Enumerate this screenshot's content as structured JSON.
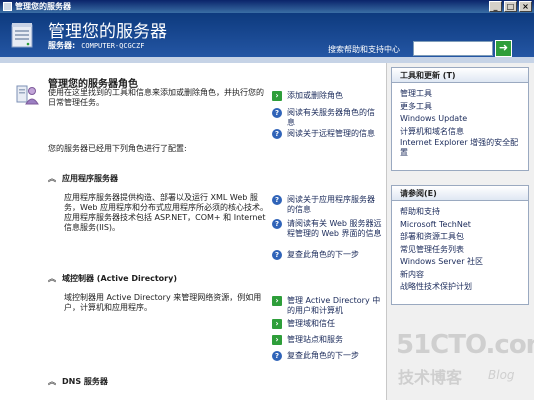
{
  "window": {
    "title": "管理您的服务器",
    "controls": [
      "_",
      "□",
      "×"
    ]
  },
  "header": {
    "title": "管理您的服务器",
    "server_label": "服务器:",
    "server_name": "COMPUTER-QCGCZF",
    "help_label": "搜索帮助和支持中心",
    "search_value": "",
    "go_glyph": "➜"
  },
  "main": {
    "heading": "管理您的服务器角色",
    "description": "使用在这里找到的工具和信息来添加或删除角色，并执行您的日常管理任务。",
    "top_links": [
      {
        "icon": "arrow",
        "label": "添加或删除角色"
      },
      {
        "icon": "help",
        "label": "阅读有关服务器角色的信息"
      },
      {
        "icon": "help",
        "label": "阅读关于远程管理的信息"
      }
    ],
    "configured_text": "您的服务器已经用下列角色进行了配置:",
    "sections": [
      {
        "title": "应用程序服务器",
        "text": "应用程序服务器提供构造、部署以及运行 XML Web 服务，Web 应用程序和分布式应用程序所必须的核心技术。应用程序服务器技术包括 ASP.NET，COM+ 和 Internet 信息服务(IIS)。",
        "links": [
          {
            "icon": "help",
            "label": "阅读关于应用程序服务器的信息"
          },
          {
            "icon": "help",
            "label": "请阅读有关 Web 服务器远程管理的 Web 界面的信息"
          },
          {
            "icon": "help",
            "label": "复查此角色的下一步"
          }
        ]
      },
      {
        "title": "域控制器 (Active Directory)",
        "text": "域控制器用 Active Directory 来管理网络资源，例如用户，计算机和应用程序。",
        "links": [
          {
            "icon": "arrow",
            "label": "管理 Active Directory 中的用户和计算机"
          },
          {
            "icon": "arrow",
            "label": "管理域和信任"
          },
          {
            "icon": "arrow",
            "label": "管理站点和服务"
          },
          {
            "icon": "help",
            "label": "复查此角色的下一步"
          }
        ]
      },
      {
        "title": "DNS 服务器",
        "text": "",
        "links": []
      }
    ]
  },
  "sidebar": {
    "tools": {
      "title": "工具和更新 (T)",
      "items": [
        "管理工具",
        "更多工具",
        "Windows Update",
        "计算机和域名信息",
        "Internet Explorer 增强的安全配置"
      ]
    },
    "see_also": {
      "title": "请参阅(E)",
      "items": [
        "帮助和支持",
        "Microsoft TechNet",
        "部署和资源工具包",
        "常见管理任务列表",
        "Windows Server 社区",
        "新内容",
        "战略性技术保护计划"
      ]
    }
  },
  "watermark": {
    "site": "51CTO.com",
    "sub": "技术博客",
    "blog": "Blog"
  },
  "colors": {
    "header_bg": "#1a4a94",
    "link_arrow": "#2e9e3a",
    "help_icon": "#2f63b8"
  }
}
